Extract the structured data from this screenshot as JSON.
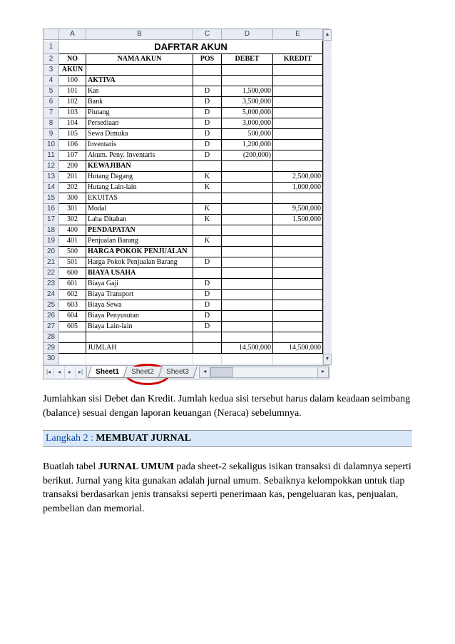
{
  "sheet": {
    "title": "DAFRTAR AKUN",
    "col_headers": [
      "A",
      "B",
      "C",
      "D",
      "E"
    ],
    "header_row2": {
      "no": "NO",
      "nama": "NAMA AKUN",
      "pos": "POS",
      "debet": "DEBET",
      "kredit": "KREDIT"
    },
    "header_row3": {
      "akun": "AKUN"
    },
    "rows": [
      {
        "r": 4,
        "no": "100",
        "nama": "AKTIVA",
        "pos": "",
        "debet": "",
        "kredit": "",
        "bold": true
      },
      {
        "r": 5,
        "no": "101",
        "nama": "Kas",
        "pos": "D",
        "debet": "1,500,000",
        "kredit": ""
      },
      {
        "r": 6,
        "no": "102",
        "nama": "Bank",
        "pos": "D",
        "debet": "3,500,000",
        "kredit": ""
      },
      {
        "r": 7,
        "no": "103",
        "nama": "Piutang",
        "pos": "D",
        "debet": "5,000,000",
        "kredit": ""
      },
      {
        "r": 8,
        "no": "104",
        "nama": "Persediaan",
        "pos": "D",
        "debet": "3,000,000",
        "kredit": ""
      },
      {
        "r": 9,
        "no": "105",
        "nama": "Sewa Dimuka",
        "pos": "D",
        "debet": "500,000",
        "kredit": ""
      },
      {
        "r": 10,
        "no": "106",
        "nama": "Inventaris",
        "pos": "D",
        "debet": "1,200,000",
        "kredit": ""
      },
      {
        "r": 11,
        "no": "107",
        "nama": "Akum. Peny. Inventaris",
        "pos": "D",
        "debet": "(200,000)",
        "kredit": ""
      },
      {
        "r": 12,
        "no": "200",
        "nama": "KEWAJIBAN",
        "pos": "",
        "debet": "",
        "kredit": "",
        "bold": true
      },
      {
        "r": 13,
        "no": "201",
        "nama": "Hutang Dagang",
        "pos": "K",
        "debet": "",
        "kredit": "2,500,000"
      },
      {
        "r": 14,
        "no": "202",
        "nama": "Hutang Lain-lain",
        "pos": "K",
        "debet": "",
        "kredit": "1,000,000"
      },
      {
        "r": 15,
        "no": "300",
        "nama": "EKUITAS",
        "pos": "",
        "debet": "",
        "kredit": ""
      },
      {
        "r": 16,
        "no": "301",
        "nama": "Modal",
        "pos": "K",
        "debet": "",
        "kredit": "9,500,000"
      },
      {
        "r": 17,
        "no": "302",
        "nama": "Laba Ditahan",
        "pos": "K",
        "debet": "",
        "kredit": "1,500,000"
      },
      {
        "r": 18,
        "no": "400",
        "nama": "PENDAPATAN",
        "pos": "",
        "debet": "",
        "kredit": "",
        "bold": true
      },
      {
        "r": 19,
        "no": "401",
        "nama": "Penjualan Barang",
        "pos": "K",
        "debet": "",
        "kredit": ""
      },
      {
        "r": 20,
        "no": "500",
        "nama": "HARGA POKOK PENJUALAN",
        "pos": "",
        "debet": "",
        "kredit": "",
        "bold": true
      },
      {
        "r": 21,
        "no": "501",
        "nama": "Harga Pokok Penjualan Barang",
        "pos": "D",
        "debet": "",
        "kredit": ""
      },
      {
        "r": 22,
        "no": "600",
        "nama": "BIAYA USAHA",
        "pos": "",
        "debet": "",
        "kredit": "",
        "bold": true
      },
      {
        "r": 23,
        "no": "601",
        "nama": "Biaya Gaji",
        "pos": "D",
        "debet": "",
        "kredit": ""
      },
      {
        "r": 24,
        "no": "602",
        "nama": "Biaya Transport",
        "pos": "D",
        "debet": "",
        "kredit": ""
      },
      {
        "r": 25,
        "no": "603",
        "nama": "Biaya Sewa",
        "pos": "D",
        "debet": "",
        "kredit": ""
      },
      {
        "r": 26,
        "no": "604",
        "nama": "Biaya Penyusutan",
        "pos": "D",
        "debet": "",
        "kredit": ""
      },
      {
        "r": 27,
        "no": "605",
        "nama": "Biaya Lain-lain",
        "pos": "D",
        "debet": "",
        "kredit": ""
      },
      {
        "r": 28,
        "no": "",
        "nama": "",
        "pos": "",
        "debet": "",
        "kredit": ""
      },
      {
        "r": 29,
        "no": "",
        "nama": "JUMLAH",
        "pos": "",
        "debet": "14,500,000",
        "kredit": "14,500,000"
      },
      {
        "r": 30,
        "no": "",
        "nama": "",
        "pos": "",
        "debet": "",
        "kredit": "",
        "noborder": true
      }
    ],
    "tabs": [
      "Sheet1",
      "Sheet2",
      "Sheet3"
    ],
    "active_tab": 0
  },
  "text": {
    "para1": "Jumlahkan sisi Debet dan Kredit. Jumlah kedua sisi tersebut harus dalam keadaan seimbang (balance) sesuai dengan laporan keuangan (Neraca) sebelumnya.",
    "step_label": "Langkah 2 : ",
    "step_title": "MEMBUAT JURNAL",
    "para2a": "Buatlah tabel ",
    "para2b": "JURNAL UMUM",
    "para2c": " pada sheet-2 sekaligus isikan transaksi di dalamnya seperti berikut. Jurnal yang kita gunakan adalah jurnal umum. Sebaiknya kelompokkan untuk tiap transaksi berdasarkan jenis transaksi seperti penerimaan kas, pengeluaran kas, penjualan, pembelian dan memorial."
  }
}
